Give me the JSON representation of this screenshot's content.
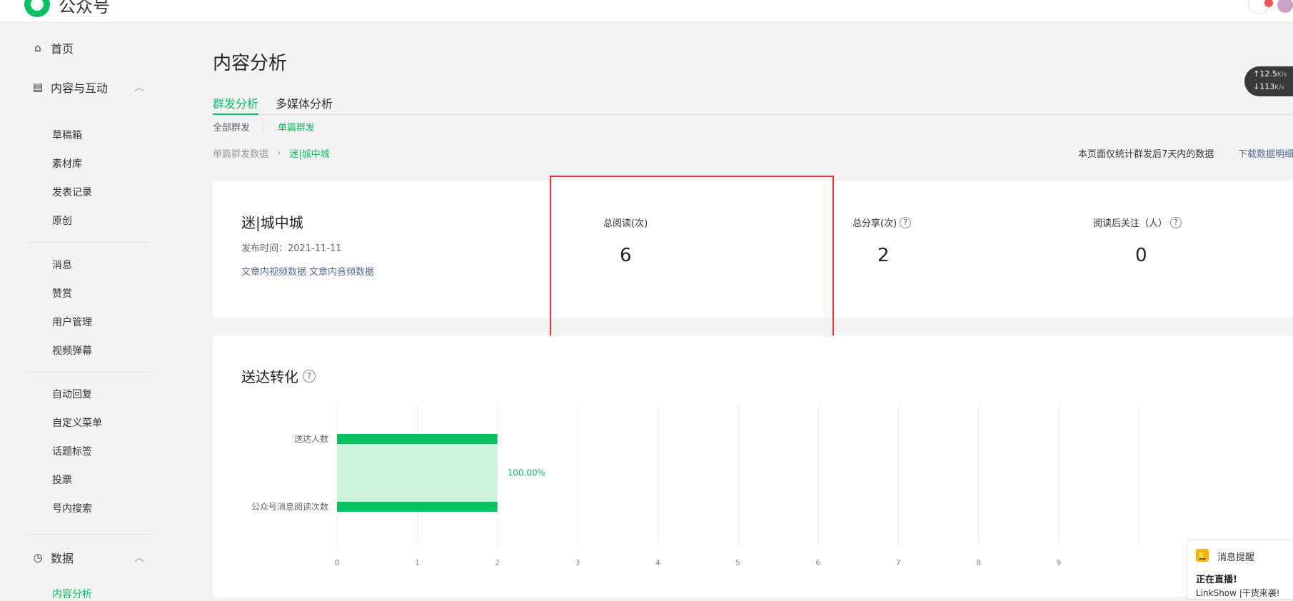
{
  "topbar": {
    "logo_text": "公众号"
  },
  "sidebar": {
    "home": "首页",
    "content_section": "内容与互动",
    "content_items": [
      "草稿箱",
      "素材库",
      "发表记录",
      "原创"
    ],
    "interact_items": [
      "消息",
      "赞赏",
      "用户管理",
      "视频弹幕"
    ],
    "func_items": [
      "自动回复",
      "自定义菜单",
      "话题标签",
      "投票",
      "号内搜索"
    ],
    "data_section": "数据",
    "data_items": [
      "内容分析"
    ]
  },
  "page": {
    "title": "内容分析",
    "tabs": [
      "群发分析",
      "多媒体分析"
    ],
    "subtabs": [
      "全部群发",
      "单篇群发"
    ],
    "breadcrumb": {
      "parent": "单篇群发数据",
      "current": "迷|城中城"
    },
    "note": "本页面仅统计群发后7天内的数据",
    "download": "下载数据明细"
  },
  "article": {
    "title": "迷|城中城",
    "publish_time": "发布时间：2021-11-11",
    "link_video": "文章内视频数据",
    "link_audio": "文章内音频数据"
  },
  "stats": [
    {
      "label": "总阅读(次)",
      "value": "6"
    },
    {
      "label": "总分享(次)",
      "value": "2"
    },
    {
      "label": "阅读后关注（人）",
      "value": "0"
    }
  ],
  "section": {
    "title": "送达转化"
  },
  "chart_data": {
    "type": "bar",
    "orientation": "horizontal",
    "categories": [
      "送达人数",
      "公众号消息阅读次数"
    ],
    "values": [
      2,
      2
    ],
    "conversion_label": "100.00%",
    "xlim": [
      0,
      10
    ],
    "x_ticks": [
      "0",
      "1",
      "2",
      "3",
      "4",
      "5",
      "6",
      "7",
      "8",
      "9"
    ],
    "colors": {
      "bar": "#07c160",
      "band": "#cdf2dc",
      "label": "#07c160"
    },
    "grid": true
  },
  "speed": {
    "up": "12.5",
    "down": "113",
    "unit": "K/s"
  },
  "toast": {
    "title": "消息提醒",
    "headline": "正在直播!",
    "body": "LinkShow |干货来袭!"
  }
}
